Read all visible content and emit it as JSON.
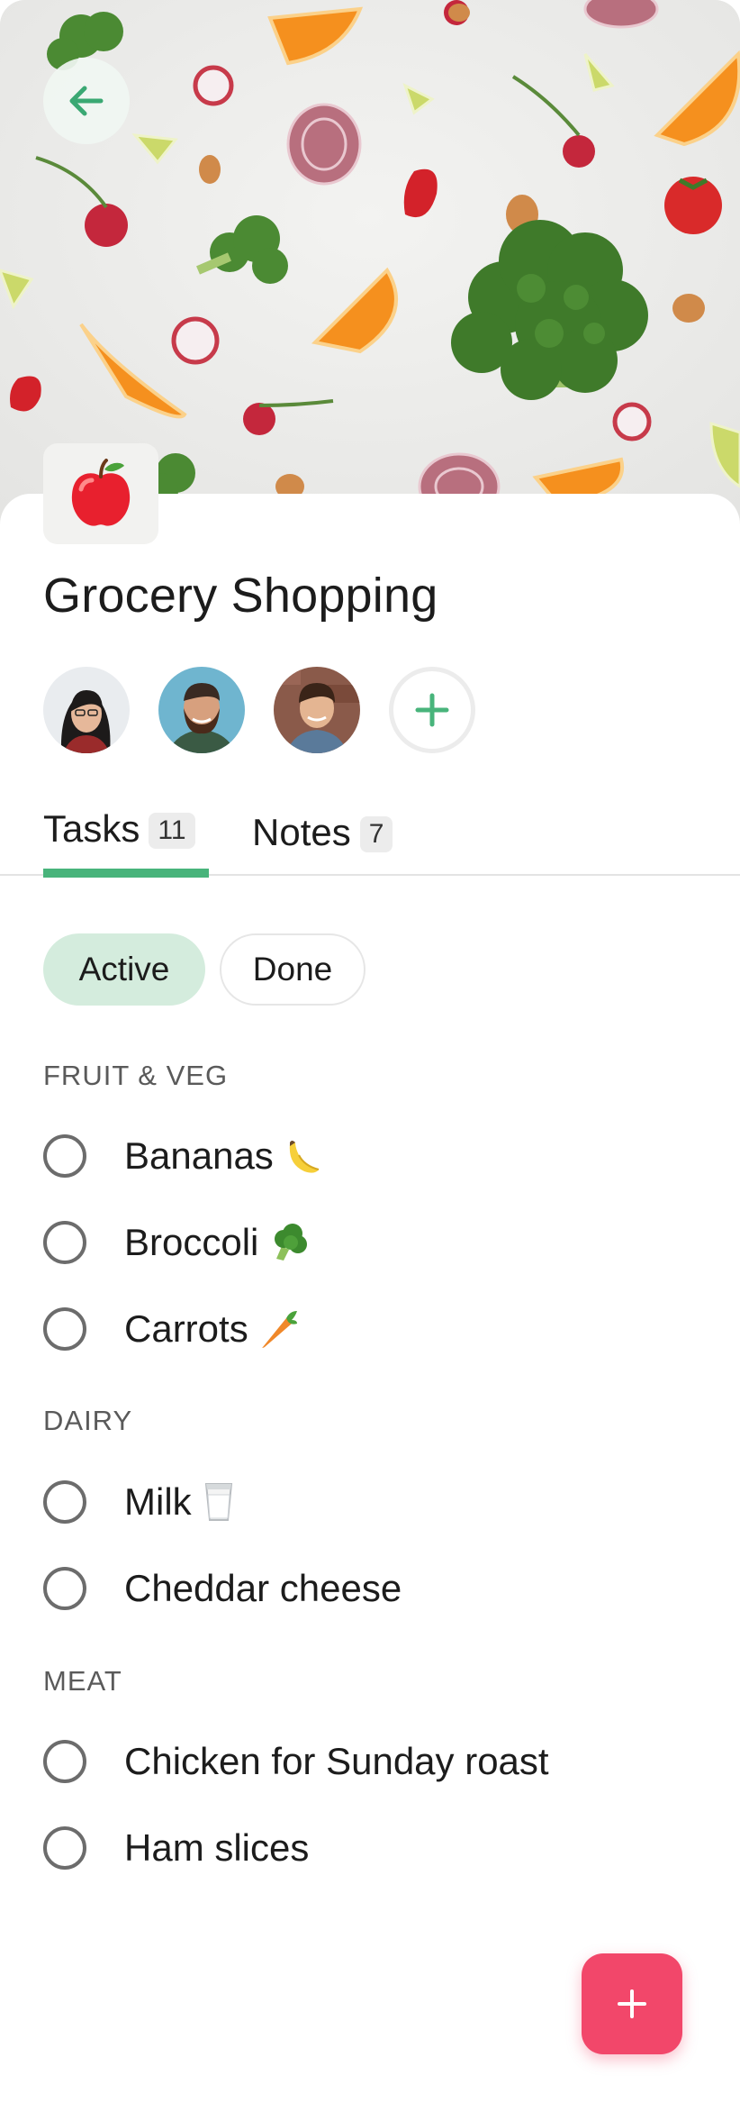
{
  "header": {
    "back_icon": "arrow-left-icon",
    "list_icon": "red-apple-icon"
  },
  "list": {
    "title": "Grocery Shopping"
  },
  "members": [
    {
      "name": "avatar-woman"
    },
    {
      "name": "avatar-man-beard"
    },
    {
      "name": "avatar-boy"
    }
  ],
  "add_member_icon": "plus-icon",
  "tabs": [
    {
      "label": "Tasks",
      "count": "11",
      "selected": true
    },
    {
      "label": "Notes",
      "count": "7",
      "selected": false
    }
  ],
  "filters": {
    "active_label": "Active",
    "done_label": "Done",
    "selected": "Active"
  },
  "sections": [
    {
      "label": "FRUIT & VEG",
      "tasks": [
        {
          "text": "Bananas",
          "emoji": "banana-icon"
        },
        {
          "text": "Broccoli",
          "emoji": "broccoli-icon"
        },
        {
          "text": "Carrots",
          "emoji": "carrot-icon"
        }
      ]
    },
    {
      "label": "DAIRY",
      "tasks": [
        {
          "text": "Milk",
          "emoji": "milk-glass-icon"
        },
        {
          "text": "Cheddar cheese",
          "emoji": ""
        }
      ]
    },
    {
      "label": "MEAT",
      "tasks": [
        {
          "text": "Chicken for Sunday roast",
          "emoji": ""
        },
        {
          "text": "Ham slices",
          "emoji": ""
        }
      ]
    }
  ],
  "fab_icon": "plus-icon",
  "colors": {
    "accent_green": "#48b47b",
    "pill_green": "#d4ecdd",
    "fab_pink": "#f2476a"
  }
}
